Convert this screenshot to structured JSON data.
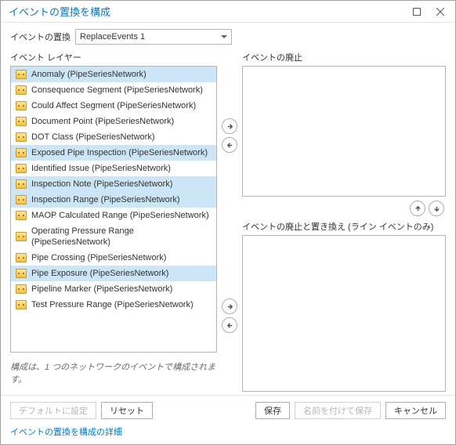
{
  "titlebar": {
    "title": "イベントの置換を構成"
  },
  "combo": {
    "label": "イベントの置換",
    "value": "ReplaceEvents 1"
  },
  "left_panel": {
    "label": "イベント レイヤー",
    "items": [
      {
        "label": "Anomaly (PipeSeriesNetwork)",
        "selected": true
      },
      {
        "label": "Consequence Segment (PipeSeriesNetwork)",
        "selected": false
      },
      {
        "label": "Could Affect Segment (PipeSeriesNetwork)",
        "selected": false
      },
      {
        "label": "Document Point (PipeSeriesNetwork)",
        "selected": false
      },
      {
        "label": "DOT Class (PipeSeriesNetwork)",
        "selected": false
      },
      {
        "label": "Exposed Pipe Inspection (PipeSeriesNetwork)",
        "selected": true
      },
      {
        "label": "Identified Issue (PipeSeriesNetwork)",
        "selected": false
      },
      {
        "label": "Inspection Note (PipeSeriesNetwork)",
        "selected": true
      },
      {
        "label": "Inspection Range (PipeSeriesNetwork)",
        "selected": true
      },
      {
        "label": "MAOP Calculated Range (PipeSeriesNetwork)",
        "selected": false
      },
      {
        "label": "Operating Pressure Range (PipeSeriesNetwork)",
        "selected": false
      },
      {
        "label": "Pipe Crossing (PipeSeriesNetwork)",
        "selected": false
      },
      {
        "label": "Pipe Exposure (PipeSeriesNetwork)",
        "selected": true
      },
      {
        "label": "Pipeline Marker (PipeSeriesNetwork)",
        "selected": false
      },
      {
        "label": "Test Pressure Range (PipeSeriesNetwork)",
        "selected": false
      }
    ]
  },
  "right_top": {
    "label": "イベントの廃止"
  },
  "right_bottom": {
    "label": "イベントの廃止と置き換え (ライン イベントのみ)"
  },
  "footnote": "構成は、1 つのネットワークのイベントで構成されます。",
  "footer": {
    "defaults_label": "デフォルトに設定",
    "reset_label": "リセット",
    "save_label": "保存",
    "save_as_label": "名前を付けて保存",
    "cancel_label": "キャンセル"
  },
  "more_link": "イベントの置換を構成の詳細"
}
